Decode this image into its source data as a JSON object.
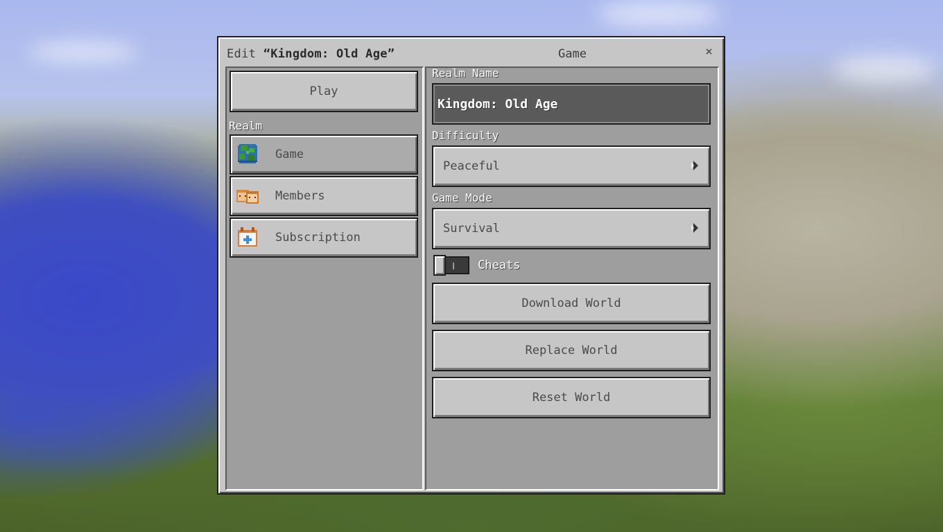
{
  "dialog": {
    "title_prefix": "Edit ",
    "realm_name_quoted": "“Kingdom: Old Age”",
    "section_title": "Game",
    "close_glyph": "×"
  },
  "sidebar": {
    "play_label": "Play",
    "section_label": "Realm",
    "items": [
      {
        "label": "Game",
        "icon": "globe-icon",
        "selected": true
      },
      {
        "label": "Members",
        "icon": "members-icon",
        "selected": false
      },
      {
        "label": "Subscription",
        "icon": "calendar-icon",
        "selected": false
      }
    ]
  },
  "settings": {
    "realm_name_label": "Realm Name",
    "realm_name_value": "Kingdom: Old Age",
    "difficulty_label": "Difficulty",
    "difficulty_value": "Peaceful",
    "game_mode_label": "Game Mode",
    "game_mode_value": "Survival",
    "cheats_label": "Cheats",
    "cheats_enabled": false,
    "download_world_label": "Download World",
    "replace_world_label": "Replace World",
    "reset_world_label": "Reset World"
  },
  "colors": {
    "panel": "#c6c6c6",
    "selected_item": "#ababab",
    "text_field": "#5a5a5a"
  }
}
